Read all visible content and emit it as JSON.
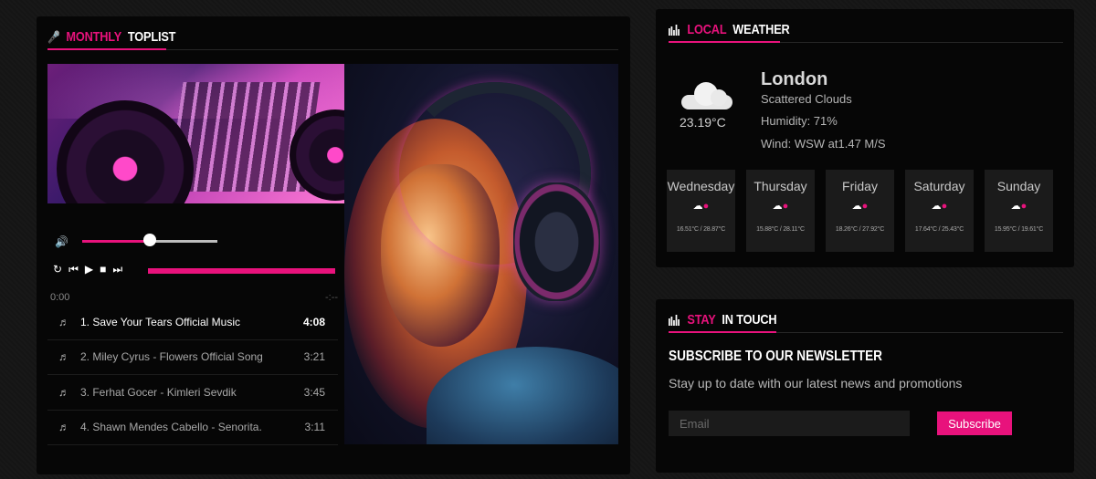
{
  "toplist": {
    "title_accent": "MONTHLY",
    "title_rest": "TOPLIST",
    "icon": "microphone-icon",
    "player": {
      "volume": 0.5,
      "progress": 1.0,
      "current_time": "0:00",
      "end_time": "-:--",
      "controls": [
        "repeat-icon",
        "previous-icon",
        "play-icon",
        "stop-icon",
        "next-icon"
      ]
    },
    "tracks": [
      {
        "name": "1. Save Your Tears Official Music",
        "duration": "4:08",
        "active": true
      },
      {
        "name": "2. Miley Cyrus - Flowers Official Song",
        "duration": "3:21",
        "active": false
      },
      {
        "name": "3. Ferhat Gocer - Kimleri Sevdik",
        "duration": "3:45",
        "active": false
      },
      {
        "name": "4. Shawn Mendes Cabello - Senorita.",
        "duration": "3:11",
        "active": false
      }
    ]
  },
  "weather": {
    "title_accent": "LOCAL",
    "title_rest": "WEATHER",
    "icon": "bar-chart-icon",
    "current": {
      "icon": "cloud-icon",
      "temperature": "23.19°C",
      "city": "London",
      "condition": "Scattered Clouds",
      "humidity": "Humidity: 71%",
      "wind": "Wind: WSW at1.47 M/S"
    },
    "forecast": [
      {
        "day": "Wednesday",
        "range": "16.51°C / 28.87°C"
      },
      {
        "day": "Thursday",
        "range": "15.88°C / 28.11°C"
      },
      {
        "day": "Friday",
        "range": "18.26°C / 27.92°C"
      },
      {
        "day": "Saturday",
        "range": "17.64°C / 25.43°C"
      },
      {
        "day": "Sunday",
        "range": "15.95°C / 19.61°C"
      }
    ]
  },
  "touch": {
    "title_accent": "STAY",
    "title_rest": "IN TOUCH",
    "icon": "bar-chart-icon",
    "newsletter_title": "SUBSCRIBE TO OUR NEWSLETTER",
    "newsletter_sub": "Stay up to date with our latest news and promotions",
    "email_placeholder": "Email",
    "subscribe_label": "Subscribe"
  },
  "colors": {
    "accent": "#e8127c",
    "panel": "#060606",
    "background": "#151515"
  }
}
